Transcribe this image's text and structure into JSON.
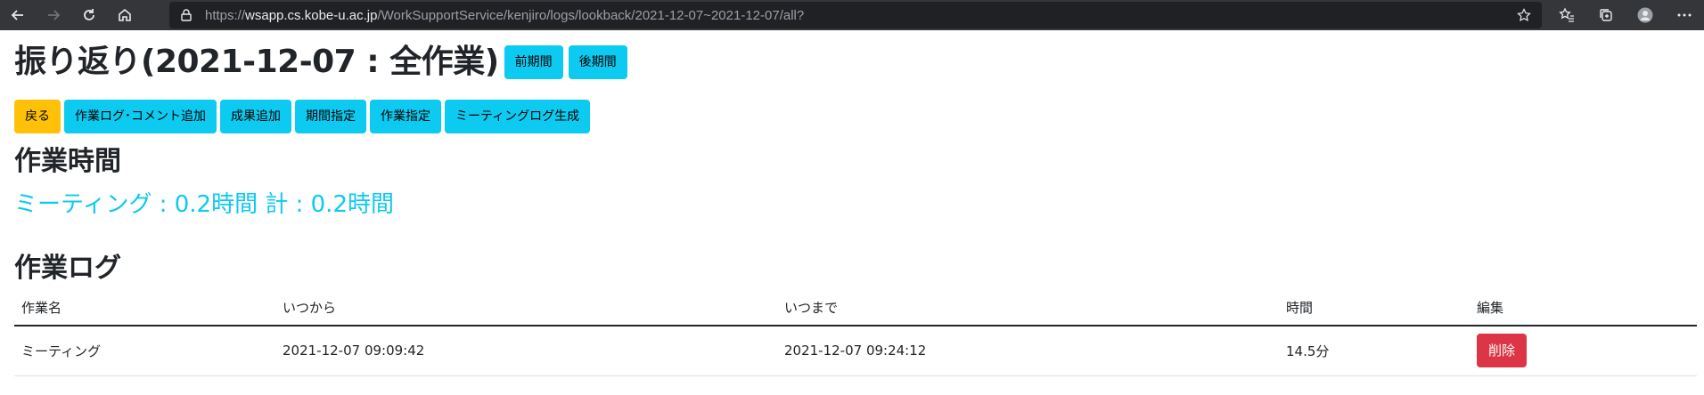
{
  "browser": {
    "url_scheme": "https://",
    "url_host": "wsapp.cs.kobe-u.ac.jp",
    "url_path": "/WorkSupportService/kenjiro/logs/lookback/2021-12-07~2021-12-07/all?"
  },
  "page": {
    "title": "振り返り(2021-12-07 : 全作業)",
    "prev_period": "前期間",
    "next_period": "後期間"
  },
  "actions": {
    "back": "戻る",
    "add_log_comment": "作業ログ･コメント追加",
    "add_result": "成果追加",
    "period_select": "期間指定",
    "work_select": "作業指定",
    "meeting_log": "ミーティングログ生成"
  },
  "work_time": {
    "heading": "作業時間",
    "summary": "ミーティング : 0.2時間 計 : 0.2時間"
  },
  "work_log": {
    "heading": "作業ログ",
    "columns": [
      "作業名",
      "いつから",
      "いつまで",
      "時間",
      "編集"
    ],
    "rows": [
      {
        "name": "ミーティング",
        "from": "2021-12-07 09:09:42",
        "to": "2021-12-07 09:24:12",
        "duration": "14.5分",
        "delete_label": "削除"
      }
    ]
  },
  "colors": {
    "info": "#0dcaf0",
    "warning": "#ffc107",
    "danger": "#dc3545"
  }
}
